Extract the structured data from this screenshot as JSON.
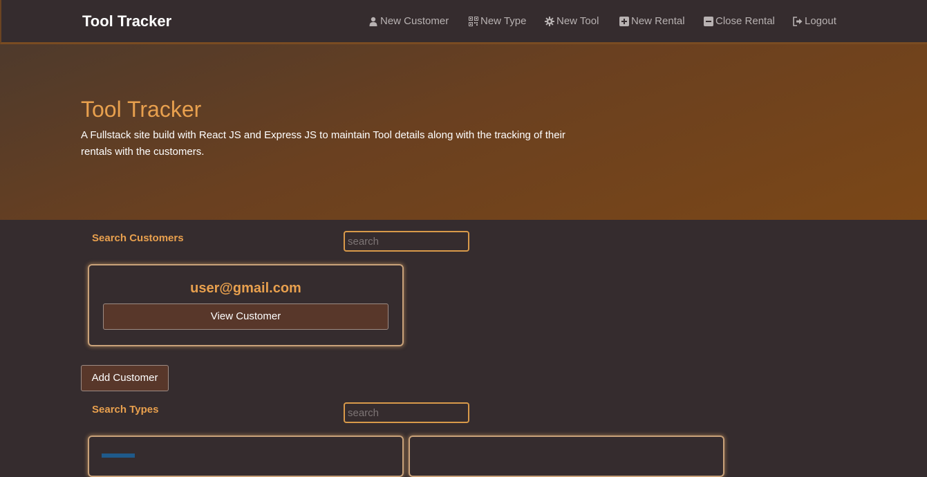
{
  "navbar": {
    "brand": "Tool Tracker",
    "links": [
      {
        "label": "New Customer",
        "icon": "user-icon"
      },
      {
        "label": "New Type",
        "icon": "qrcode-icon"
      },
      {
        "label": "New Tool",
        "icon": "gear-icon"
      },
      {
        "label": "New Rental",
        "icon": "plus-square-icon"
      },
      {
        "label": "Close Rental",
        "icon": "minus-square-icon"
      },
      {
        "label": "Logout",
        "icon": "logout-icon"
      }
    ]
  },
  "hero": {
    "title": "Tool Tracker",
    "description": "A Fullstack site build with React JS and Express JS to maintain Tool details along with the tracking of their rentals with the customers."
  },
  "customers": {
    "section_label": "Search Customers",
    "search_placeholder": "search",
    "cards": [
      {
        "email": "user@gmail.com",
        "button_label": "View Customer"
      }
    ],
    "add_button_label": "Add Customer"
  },
  "types": {
    "section_label": "Search Types",
    "search_placeholder": "search"
  },
  "colors": {
    "accent": "#e8a04e",
    "background": "#352c2e",
    "button": "#58372a"
  }
}
